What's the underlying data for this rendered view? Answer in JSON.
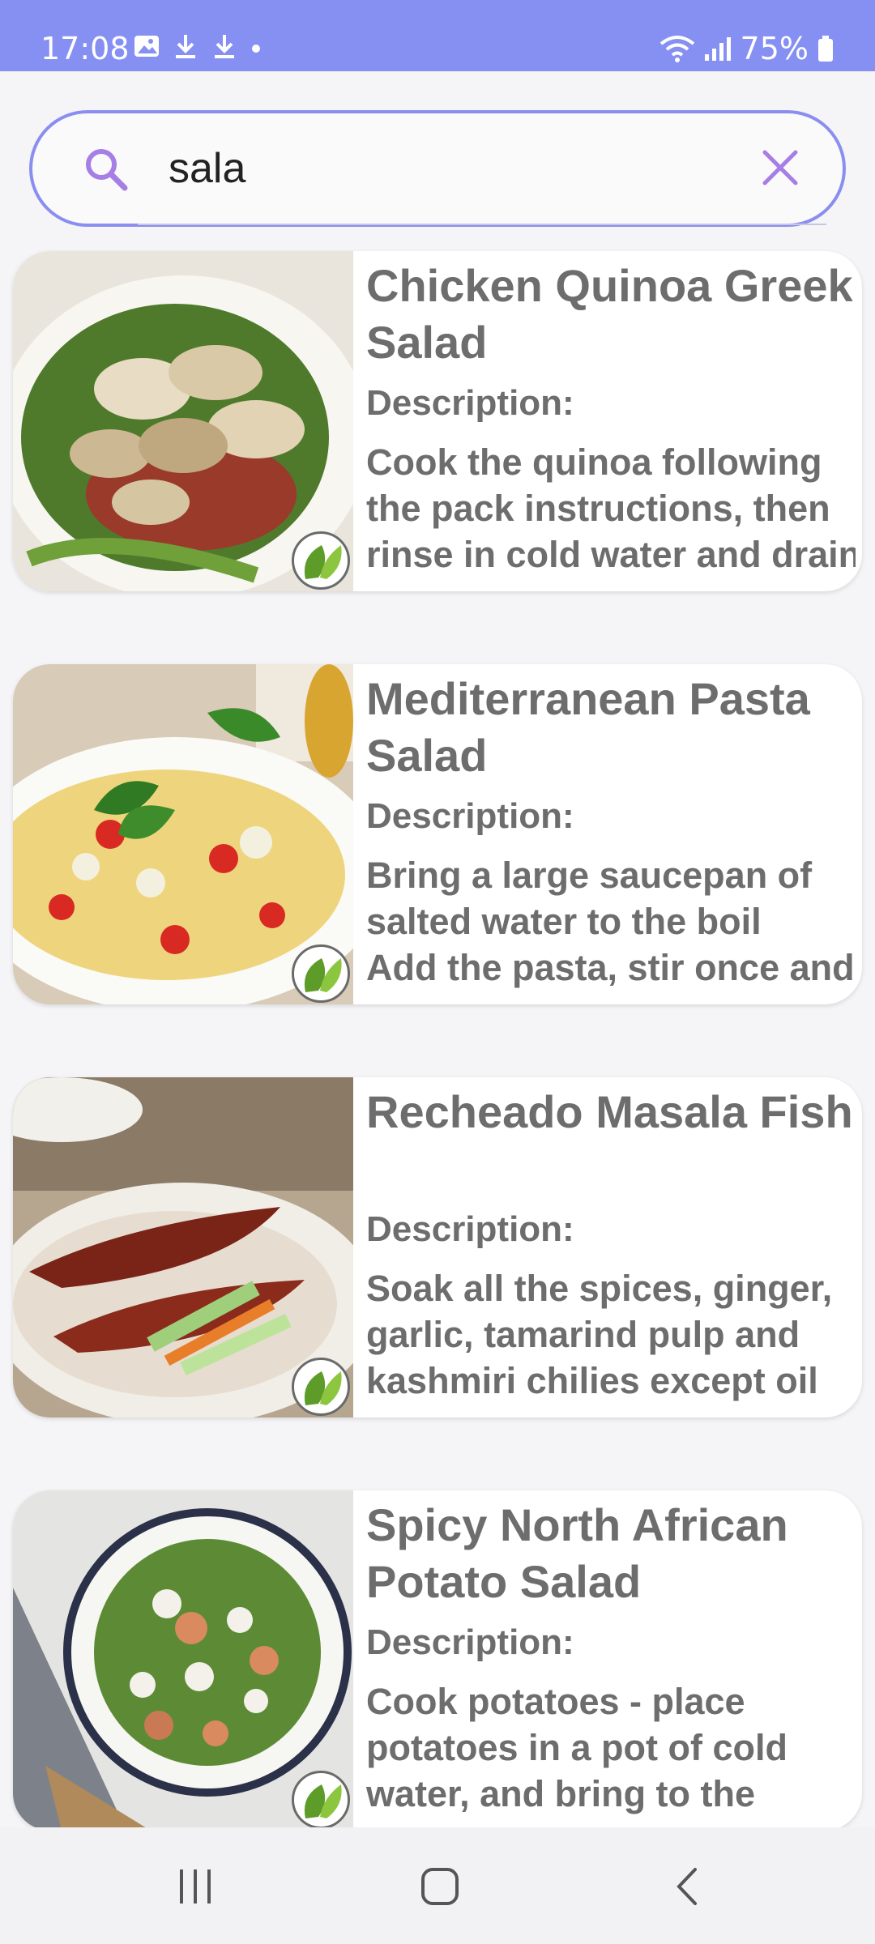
{
  "status_bar": {
    "time": "17:08",
    "battery": "75%",
    "background": "#8690f2"
  },
  "search": {
    "value": "sala",
    "placeholder": "",
    "accent": "#8a8ef0"
  },
  "description_label": "Description:",
  "recipes": [
    {
      "title": "Chicken Quinoa Greek Salad",
      "description_lines": [
        "Cook the quinoa following",
        "the pack instructions, then",
        "rinse in cold water and drain"
      ]
    },
    {
      "title": "Mediterranean Pasta Salad",
      "description_lines": [
        "Bring a large saucepan of",
        "salted water to the boil",
        "Add the pasta, stir once and"
      ]
    },
    {
      "title": "Recheado Masala Fish",
      "description_lines": [
        "Soak all the spices, ginger,",
        "garlic, tamarind pulp and",
        "kashmiri chilies except oil"
      ]
    },
    {
      "title": "Spicy North African Potato Salad",
      "description_lines": [
        "Cook potatoes - place",
        "potatoes in a pot of cold",
        "water, and bring to the"
      ]
    }
  ],
  "icons": {
    "search": "search-icon",
    "clear": "close-icon",
    "veg": "leaf-icon",
    "nav": [
      "recents-icon",
      "home-icon",
      "back-icon"
    ]
  }
}
